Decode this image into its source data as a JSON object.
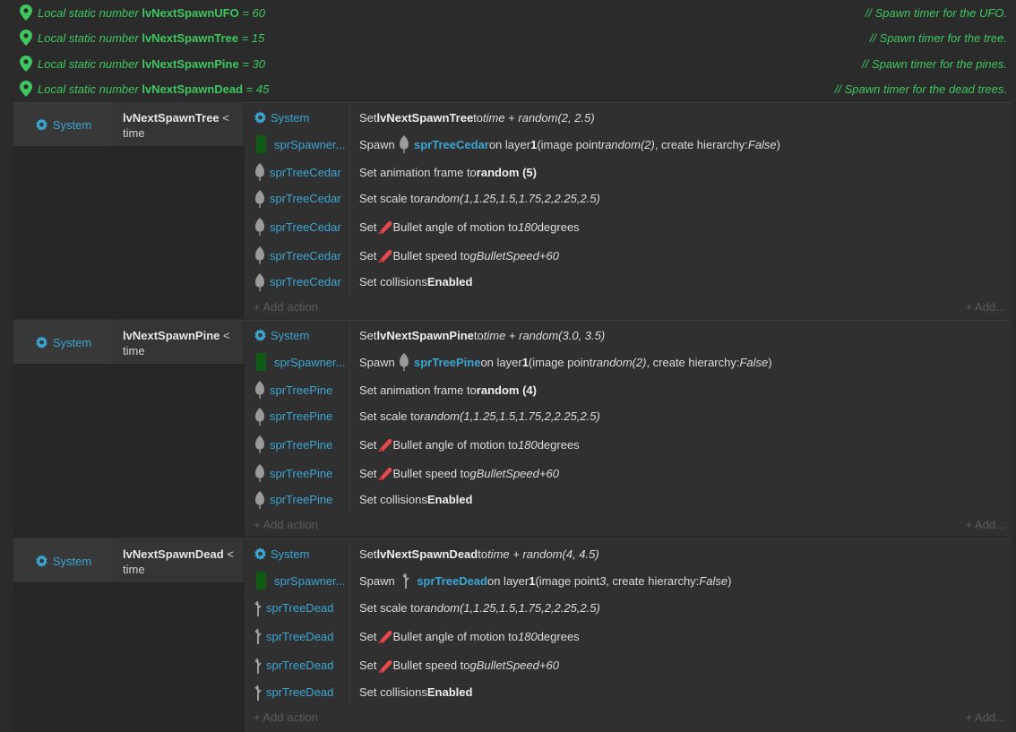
{
  "variables": [
    {
      "prefix": "Local static number ",
      "name": "lvNextSpawnUFO",
      "suffix": " = 60",
      "comment": "//  Spawn timer for the UFO."
    },
    {
      "prefix": "Local static number ",
      "name": "lvNextSpawnTree",
      "suffix": " = 15",
      "comment": "//  Spawn timer for the tree."
    },
    {
      "prefix": "Local static number ",
      "name": "lvNextSpawnPine",
      "suffix": " = 30",
      "comment": "//  Spawn timer for the pines."
    },
    {
      "prefix": "Local static number ",
      "name": "lvNextSpawnDead",
      "suffix": " = 45",
      "comment": "//  Spawn timer for the dead trees."
    }
  ],
  "ui": {
    "system": "System",
    "add_action": "+ Add action",
    "add": "+ Add...",
    "lt": " <",
    "time": "time",
    "spawner": "sprSpawner..."
  },
  "events": [
    {
      "var": "lvNextSpawnTree",
      "sprite": "sprTreeCedar",
      "a1": {
        "set": "Set ",
        "var": "lvNextSpawnTree",
        "to": " to ",
        "expr": "time + random(2, 2.5)"
      },
      "a2": {
        "spawn": "Spawn",
        "obj": "sprTreeCedar",
        "layer_pre": " on layer ",
        "layer": "1",
        "ip_pre": " (image point ",
        "ip": "random(2)",
        "ch_pre": ", create hierarchy: ",
        "ch": "False",
        "close": ")"
      },
      "a3": {
        "pre": "Set animation frame to ",
        "val": "random (5)"
      },
      "a4": {
        "pre": "Set scale to ",
        "val": "random(1,1.25,1.5,1.75,2,2.25,2.5)"
      },
      "a5": {
        "pre": "Set ",
        "mid": " Bullet angle of motion to ",
        "val": "180",
        "post": " degrees"
      },
      "a6": {
        "pre": "Set ",
        "mid": " Bullet speed to ",
        "val": "gBulletSpeed+60"
      },
      "a7": {
        "pre": "Set collisions ",
        "val": "Enabled"
      }
    },
    {
      "var": "lvNextSpawnPine",
      "sprite": "sprTreePine",
      "a1": {
        "set": "Set ",
        "var": "lvNextSpawnPine",
        "to": " to ",
        "expr": "time + random(3.0, 3.5)"
      },
      "a2": {
        "spawn": "Spawn",
        "obj": "sprTreePine",
        "layer_pre": " on layer ",
        "layer": "1",
        "ip_pre": " (image point ",
        "ip": "random(2)",
        "ch_pre": ", create hierarchy: ",
        "ch": "False",
        "close": ")"
      },
      "a3": {
        "pre": "Set animation frame to ",
        "val": "random (4)"
      },
      "a4": {
        "pre": "Set scale to ",
        "val": "random(1,1.25,1.5,1.75,2,2.25,2.5)"
      },
      "a5": {
        "pre": "Set ",
        "mid": " Bullet angle of motion to ",
        "val": "180",
        "post": " degrees"
      },
      "a6": {
        "pre": "Set ",
        "mid": " Bullet speed to ",
        "val": "gBulletSpeed+60"
      },
      "a7": {
        "pre": "Set collisions ",
        "val": "Enabled"
      }
    },
    {
      "var": "lvNextSpawnDead",
      "sprite": "sprTreeDead",
      "a1": {
        "set": "Set ",
        "var": "lvNextSpawnDead",
        "to": " to ",
        "expr": "time + random(4, 4.5)"
      },
      "a2": {
        "spawn": "Spawn",
        "obj": "sprTreeDead",
        "layer_pre": " on layer ",
        "layer": "1",
        "ip_pre": " (image point ",
        "ip": "3",
        "ch_pre": ", create hierarchy: ",
        "ch": "False",
        "close": ")"
      },
      "a4": {
        "pre": "Set scale to ",
        "val": "random(1,1.25,1.5,1.75,2,2.25,2.5)"
      },
      "a5": {
        "pre": "Set ",
        "mid": " Bullet angle of motion to ",
        "val": "180",
        "post": " degrees"
      },
      "a6": {
        "pre": "Set ",
        "mid": " Bullet speed to ",
        "val": "gBulletSpeed+60"
      },
      "a7": {
        "pre": "Set collisions ",
        "val": "Enabled"
      }
    }
  ]
}
